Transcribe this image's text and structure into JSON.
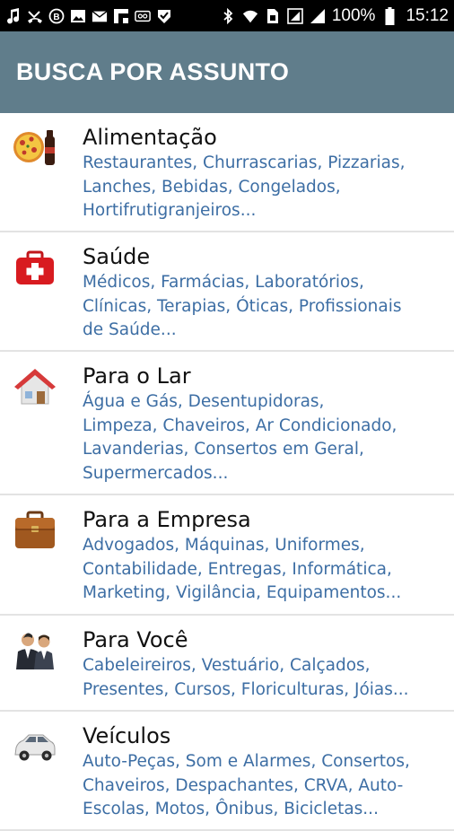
{
  "status_bar": {
    "battery_percent": "100%",
    "time": "15:12",
    "left_icons": [
      "music-note-icon",
      "missed-call-icon",
      "b-badge-icon",
      "image-icon",
      "mail-icon",
      "flipboard-icon",
      "voicemail-icon",
      "check-shield-icon"
    ],
    "right_icons": [
      "bluetooth-icon",
      "wifi-icon",
      "sim-icon",
      "screen-icon",
      "signal-icon",
      "battery-icon"
    ]
  },
  "app_bar": {
    "title": "BUSCA POR ASSUNTO",
    "color": "#607d8b"
  },
  "categories": [
    {
      "title": "Alimentação",
      "icon": "pizza-soda-icon",
      "subtitle": "Restaurantes, Churrascarias, Pizzarias,\nLanches, Bebidas, Congelados,\nHortifrutigranjeiros..."
    },
    {
      "title": "Saúde",
      "icon": "first-aid-kit-icon",
      "subtitle": "Médicos, Farmácias, Laboratórios,\nClínicas, Terapias, Óticas, Profissionais\nde Saúde..."
    },
    {
      "title": "Para o Lar",
      "icon": "house-icon",
      "subtitle": "Água e Gás, Desentupidoras,\nLimpeza, Chaveiros, Ar Condicionado,\nLavanderias, Consertos em Geral,\nSupermercados..."
    },
    {
      "title": "Para a Empresa",
      "icon": "briefcase-icon",
      "subtitle": "Advogados, Máquinas, Uniformes,\nContabilidade, Entregas, Informática,\nMarketing, Vigilância, Equipamentos..."
    },
    {
      "title": "Para Você",
      "icon": "businesspeople-icon",
      "subtitle": "Cabeleireiros, Vestuário, Calçados,\nPresentes, Cursos, Floriculturas, Jóias..."
    },
    {
      "title": "Veículos",
      "icon": "car-icon",
      "subtitle": "Auto-Peças, Som e Alarmes, Consertos,\nChaveiros, Despachantes, CRVA, Auto-\nEscolas, Motos, Ônibus, Bicicletas..."
    }
  ],
  "colors": {
    "subtitle": "#3d6ea4",
    "divider": "#e3e3e3"
  }
}
